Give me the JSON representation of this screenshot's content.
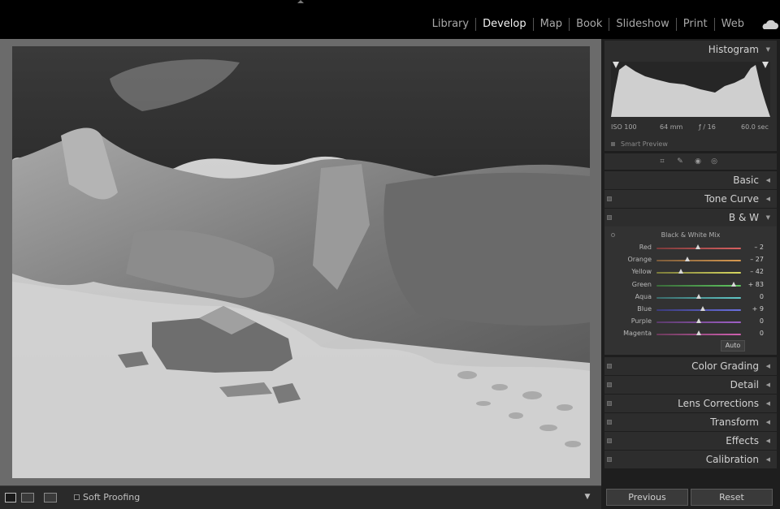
{
  "modules": [
    "Library",
    "Develop",
    "Map",
    "Book",
    "Slideshow",
    "Print",
    "Web"
  ],
  "active_module": "Develop",
  "histogram": {
    "title": "Histogram",
    "iso": "ISO 100",
    "focal": "64 mm",
    "aperture": "ƒ / 16",
    "shutter": "60.0 sec",
    "smart_preview": "Smart Preview"
  },
  "panels": {
    "basic": "Basic",
    "tone_curve": "Tone Curve",
    "bw": "B & W",
    "color_grading": "Color Grading",
    "detail": "Detail",
    "lens": "Lens Corrections",
    "transform": "Transform",
    "effects": "Effects",
    "calibration": "Calibration"
  },
  "bw_mix": {
    "subtitle": "Black & White Mix",
    "auto_label": "Auto",
    "sliders": [
      {
        "label": "Red",
        "value": "– 2",
        "level": -2,
        "colors": [
          "#7a3a3a",
          "#d86060"
        ]
      },
      {
        "label": "Orange",
        "value": "– 27",
        "level": -27,
        "colors": [
          "#7a5a3a",
          "#d89a50"
        ]
      },
      {
        "label": "Yellow",
        "value": "– 42",
        "level": -42,
        "colors": [
          "#7a7a3a",
          "#d8d860"
        ]
      },
      {
        "label": "Green",
        "value": "+ 83",
        "level": 83,
        "colors": [
          "#3a6a3a",
          "#60c860"
        ]
      },
      {
        "label": "Aqua",
        "value": "0",
        "level": 0,
        "colors": [
          "#3a6a6a",
          "#60c8c8"
        ]
      },
      {
        "label": "Blue",
        "value": "+ 9",
        "level": 9,
        "colors": [
          "#3a3a7a",
          "#6a70e0"
        ]
      },
      {
        "label": "Purple",
        "value": "0",
        "level": 0,
        "colors": [
          "#5a3a6a",
          "#a060c8"
        ]
      },
      {
        "label": "Magenta",
        "value": "0",
        "level": 0,
        "colors": [
          "#6a3a5a",
          "#d060b0"
        ]
      }
    ]
  },
  "toolbar": {
    "soft_proofing": "Soft Proofing"
  },
  "buttons": {
    "previous": "Previous",
    "reset": "Reset"
  }
}
